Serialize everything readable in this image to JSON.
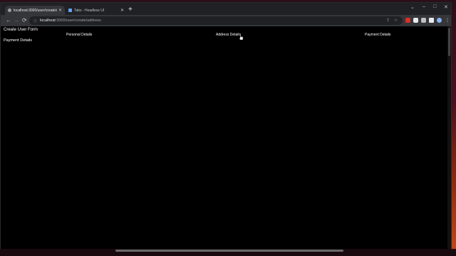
{
  "browser": {
    "tabs": [
      {
        "title": "localhost:3000/user/create/address",
        "active": true,
        "icon": "globe-icon"
      },
      {
        "title": "Tabs - Headless UI",
        "active": false,
        "icon": "headlessui-icon"
      }
    ],
    "new_tab_label": "+",
    "window_controls": {
      "minimize": "–",
      "maximize": "□",
      "close": "✕",
      "dropdown": "⌄"
    },
    "nav": {
      "back": "←",
      "forward": "→",
      "reload": "⟳"
    },
    "url_host": "localhost",
    "url_path": ":3000/user/create/address",
    "omnibox_icons": {
      "share": "⇪",
      "star": "☆"
    }
  },
  "page": {
    "form_title": "Create User Form",
    "tabs": [
      {
        "label": "Personal Details"
      },
      {
        "label": "Address Details"
      },
      {
        "label": "Payment Details"
      }
    ],
    "panel_title": "Payment Details"
  },
  "colors": {
    "page_bg": "#000000",
    "tabstrip_bg": "#202124",
    "toolbar_bg": "#35363a",
    "text": "#ffffff"
  }
}
